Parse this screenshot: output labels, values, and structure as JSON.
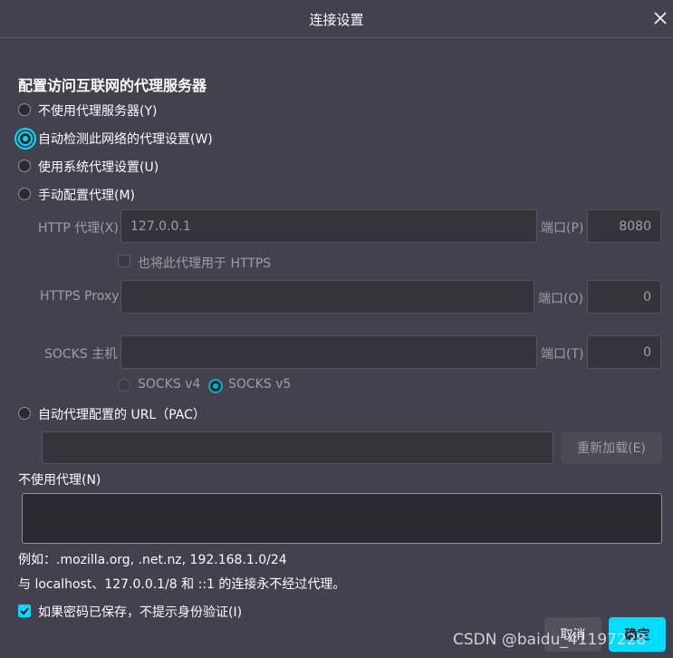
{
  "dialog": {
    "title": "连接设置"
  },
  "proxy": {
    "heading": "配置访问互联网的代理服务器",
    "options": [
      {
        "label": "不使用代理服务器(Y)"
      },
      {
        "label": "自动检测此网络的代理设置(W)"
      },
      {
        "label": "使用系统代理设置(U)"
      },
      {
        "label": "手动配置代理(M)"
      }
    ],
    "http_label": "HTTP 代理(X)",
    "http_value": "127.0.0.1",
    "http_port_label": "端口(P)",
    "http_port_value": "8080",
    "also_https_label": "也将此代理用于 HTTPS",
    "https_label": "HTTPS Proxy",
    "https_value": "",
    "https_port_label": "端口(O)",
    "https_port_value": "0",
    "socks_label": "SOCKS 主机",
    "socks_value": "",
    "socks_port_label": "端口(T)",
    "socks_port_value": "0",
    "socks_v4_label": "SOCKS v4",
    "socks_v5_label": "SOCKS v5",
    "pac_label": "自动代理配置的 URL（PAC）",
    "pac_value": "",
    "reload_label": "重新加载(E)",
    "no_proxy_label": "不使用代理(N)",
    "no_proxy_value": "",
    "example_text": "例如：.mozilla.org, .net.nz, 192.168.1.0/24",
    "localhost_note": "与 localhost、127.0.0.1/8 和 ::1 的连接永不经过代理。",
    "no_auth_prompt_label": "如果密码已保存，不提示身份验证(I)"
  },
  "footer": {
    "cancel_label": "取消",
    "ok_label": "确定"
  },
  "watermark": "CSDN @baidu_41197228",
  "colors": {
    "accent": "#00ddff",
    "background": "#42414d"
  }
}
